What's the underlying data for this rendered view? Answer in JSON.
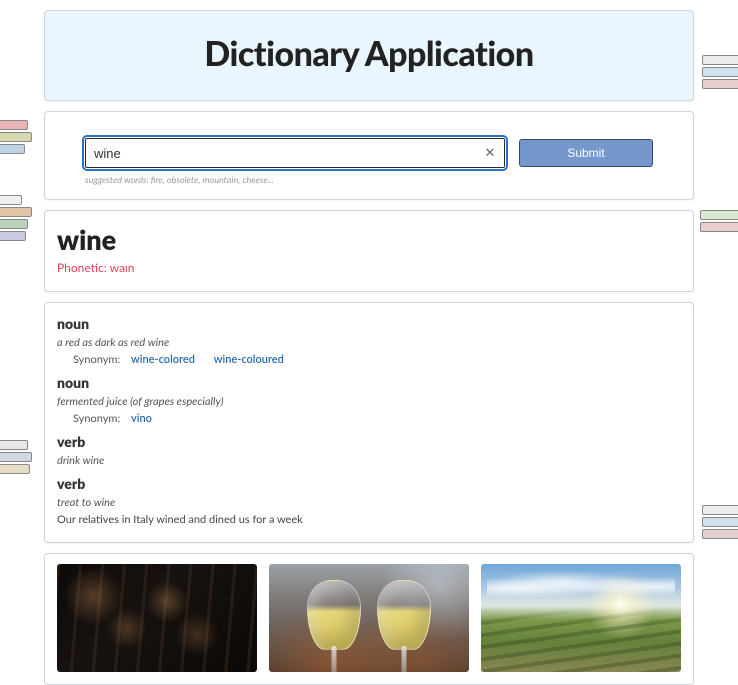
{
  "header": {
    "title": "Dictionary Application"
  },
  "search": {
    "value": "wine",
    "clear_glyph": "✕",
    "submit_label": "Submit",
    "suggested_label": "suggested words: fire, obsolete, mountain, cheese..."
  },
  "word": {
    "headword": "wine",
    "phonetic": "Phonetic: waɪn"
  },
  "definitions": [
    {
      "pos": "noun",
      "def": "a red as dark as red wine",
      "syn_label": "Synonym:",
      "synonyms": [
        "wine-colored",
        "wine-coloured"
      ]
    },
    {
      "pos": "noun",
      "def": "fermented juice (of grapes especially)",
      "syn_label": "Synonym:",
      "synonyms": [
        "vino"
      ]
    },
    {
      "pos": "verb",
      "def": "drink wine"
    },
    {
      "pos": "verb",
      "def": "treat to wine",
      "example": "Our relatives in Italy wined and dined us for a week"
    }
  ],
  "images": {
    "alt1": "wine cellar",
    "alt2": "wine glasses",
    "alt3": "vineyard"
  }
}
